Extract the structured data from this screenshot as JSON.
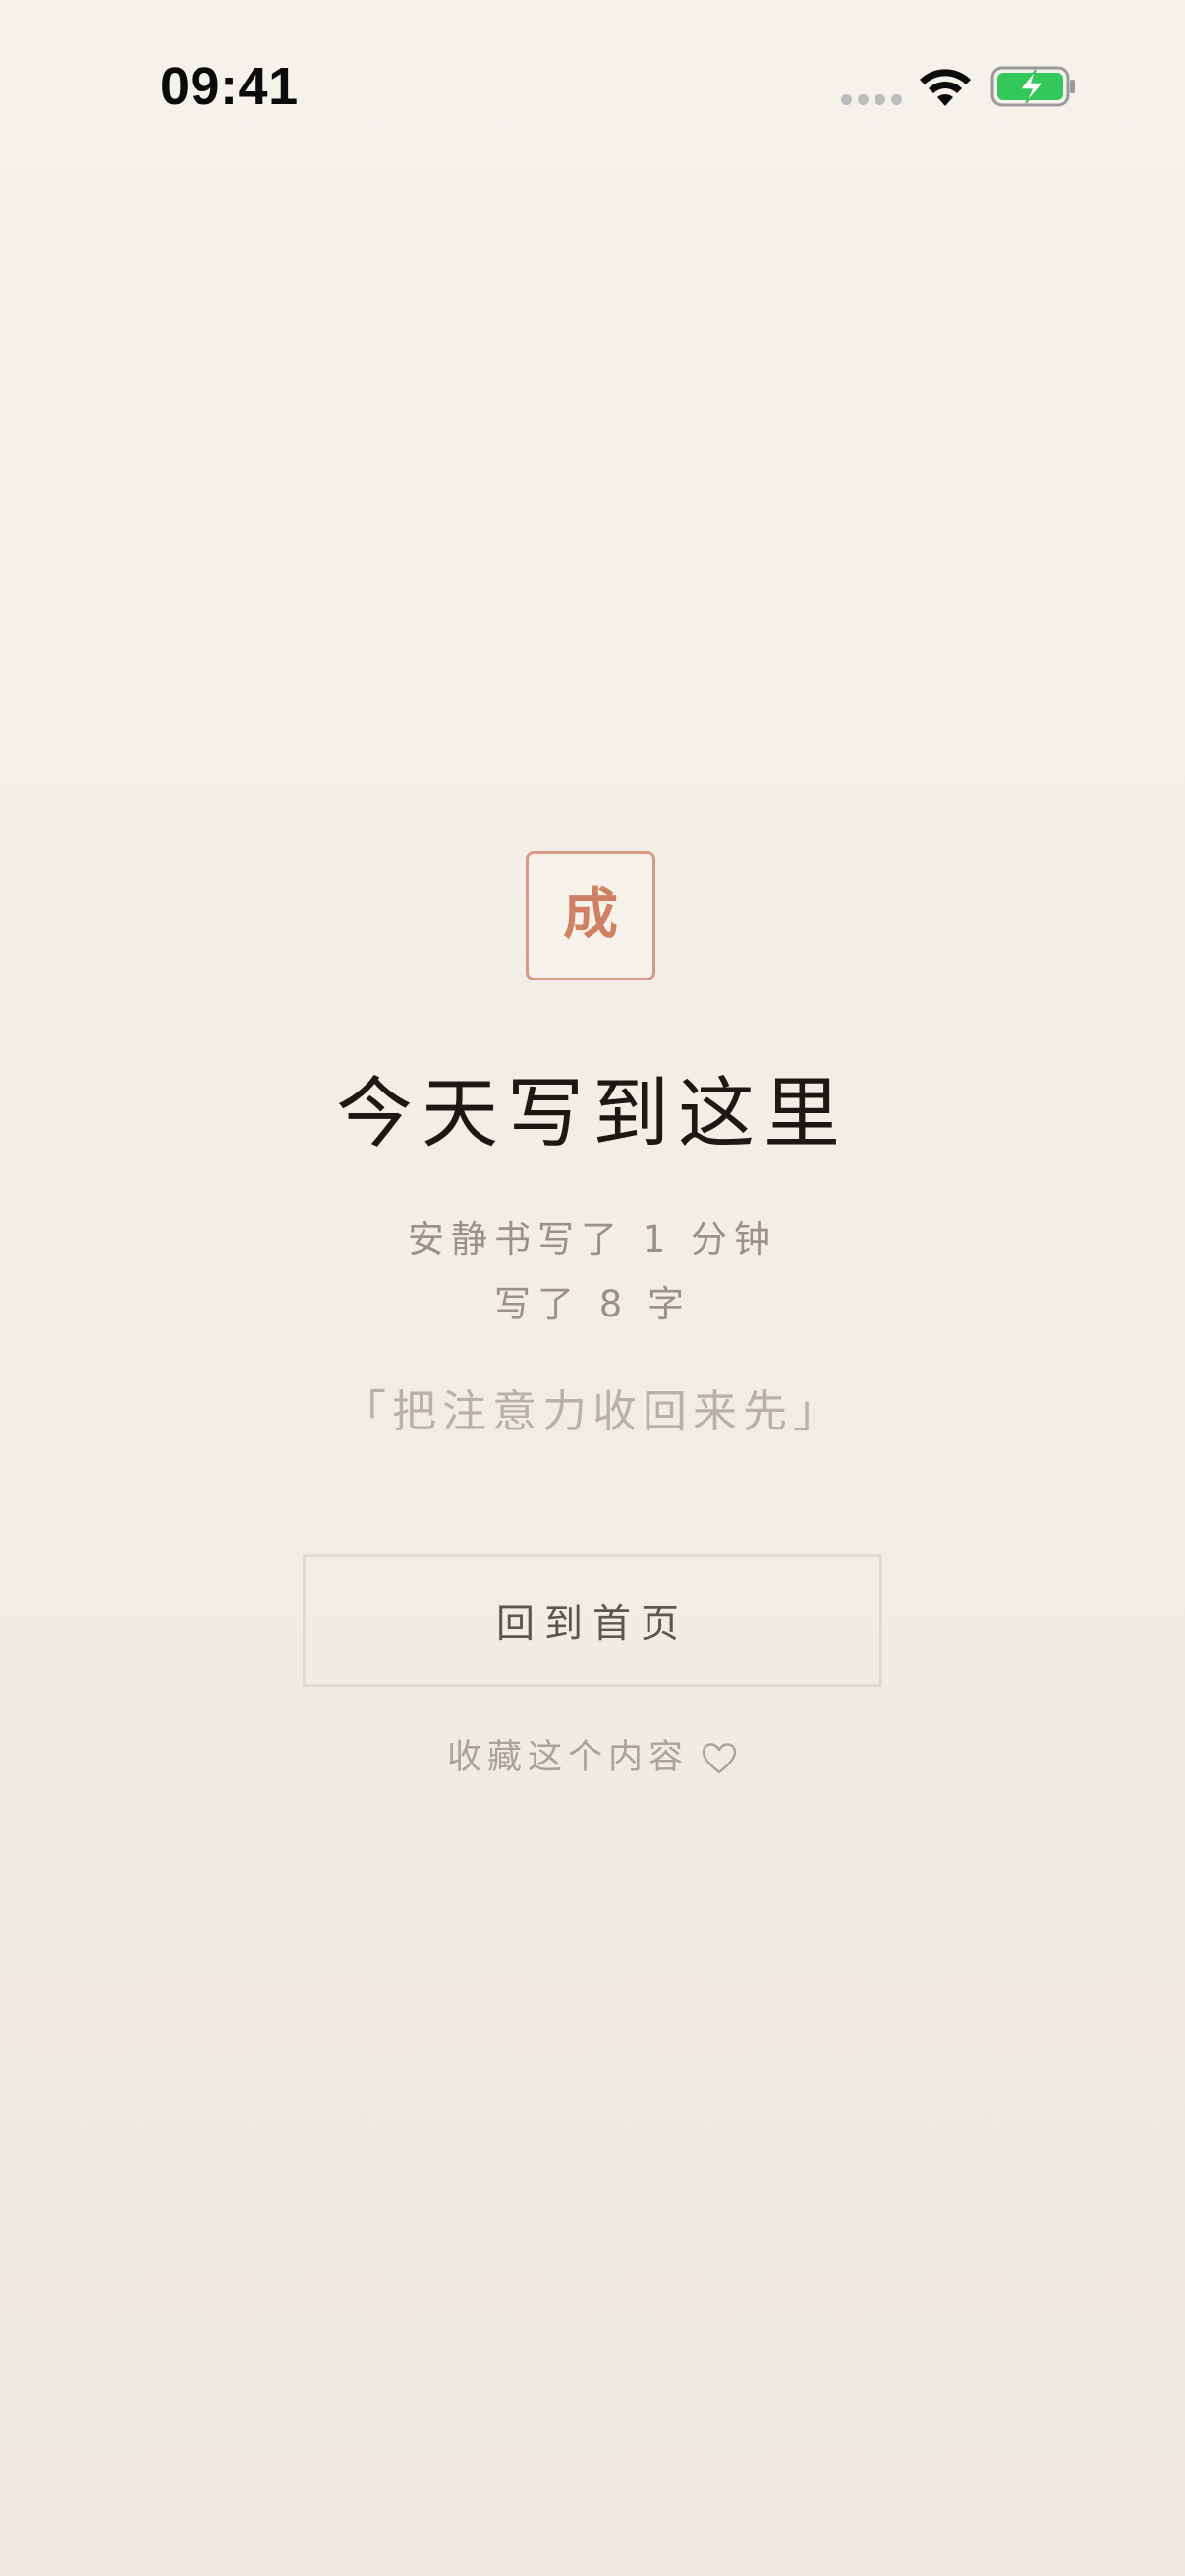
{
  "status_bar": {
    "time": "09:41",
    "icons": [
      "signal-dots-icon",
      "wifi-icon",
      "battery-charging-icon"
    ],
    "battery_color": "#34c759"
  },
  "completion": {
    "seal_char": "成",
    "title": "今天写到这里",
    "duration_text": "安静书写了 1 分钟",
    "words_text": "写了 8 字",
    "quote": "「把注意力收回来先」"
  },
  "actions": {
    "home_button_label": "回到首页",
    "favorite_label": "收藏这个内容",
    "favorite_icon": "heart-outline-icon"
  },
  "colors": {
    "accent": "#d08163",
    "seal_border": "#d89a86",
    "background": "#f2eee6",
    "title": "#1e1713",
    "muted_text": "#9b9187"
  }
}
